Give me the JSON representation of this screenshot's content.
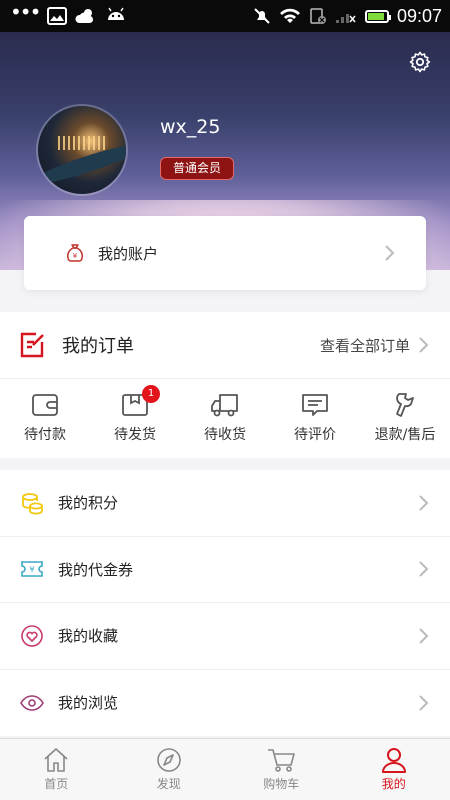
{
  "status_bar": {
    "time": "09:07"
  },
  "profile": {
    "username": "wx_25",
    "member_level": "普通会员"
  },
  "account": {
    "label": "我的账户"
  },
  "orders": {
    "title": "我的订单",
    "view_all": "查看全部订单",
    "statuses": [
      {
        "label": "待付款",
        "icon": "wallet-icon"
      },
      {
        "label": "待发货",
        "icon": "package-icon",
        "badge": "1"
      },
      {
        "label": "待收货",
        "icon": "truck-icon"
      },
      {
        "label": "待评价",
        "icon": "comment-icon"
      },
      {
        "label": "退款/售后",
        "icon": "wrench-icon"
      }
    ]
  },
  "menu": [
    {
      "label": "我的积分",
      "icon": "coins-icon"
    },
    {
      "label": "我的代金券",
      "icon": "voucher-icon"
    },
    {
      "label": "我的收藏",
      "icon": "heart-icon"
    },
    {
      "label": "我的浏览",
      "icon": "eye-icon"
    }
  ],
  "tabbar": {
    "active": "我的",
    "tabs": [
      {
        "label": "首页",
        "icon": "home-icon"
      },
      {
        "label": "发现",
        "icon": "compass-icon"
      },
      {
        "label": "购物车",
        "icon": "cart-icon"
      },
      {
        "label": "我的",
        "icon": "user-icon"
      }
    ]
  },
  "colors": {
    "accent_red": "#d6141d",
    "badge_red": "#e3141c",
    "member_badge": "#8e1414",
    "coin_yellow": "#f2c811",
    "voucher_teal": "#3aa6c7"
  }
}
